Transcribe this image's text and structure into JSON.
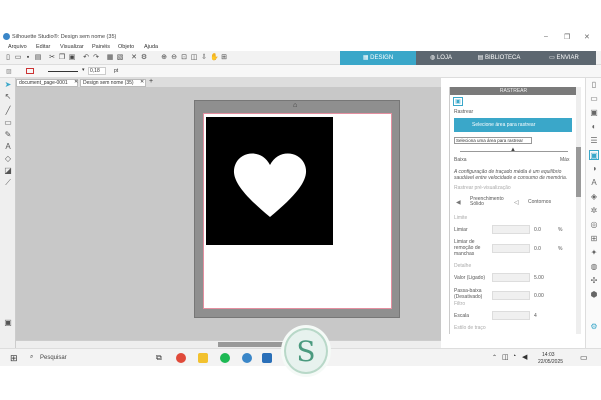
{
  "window": {
    "title": "Silhouette Studio®: Design sem nome (35)"
  },
  "menu": [
    "Arquivo",
    "Editar",
    "Visualizar",
    "Painéis",
    "Objeto",
    "Ajuda"
  ],
  "nav_tabs": [
    "DESIGN",
    "LOJA",
    "BIBLIOTECA",
    "ENVIAR"
  ],
  "options_bar": {
    "line_width": "0,18",
    "unit": "pt"
  },
  "doc_tabs": [
    "document_page-0001",
    "Design sem nome (35)"
  ],
  "panel": {
    "header": "RASTREAR",
    "section_label": "Rastrear",
    "select_button": "Selecione área para rastrear",
    "tooltip": "Seleciona uma área para rastrear",
    "low_label": "Baixa",
    "high_label": "Máx",
    "description": "A configuração de traçado média é um equilíbrio saudável entre velocidade e consumo de memória.",
    "preview_label": "Rastrear pré-visualização",
    "mode_solid": "Preenchimento Sólido",
    "mode_outline": "Contornos",
    "limit_section": "Limite",
    "threshold_label": "Limiar",
    "threshold_value": "0.0",
    "threshold_unit": "%",
    "noise_label": "Limiar de remoção de manchas",
    "noise_value": "0.0",
    "noise_unit": "%",
    "detail_section": "Detalhe",
    "smooth_label": "Valor (Ligado)",
    "smooth_value": "5.00",
    "filter_section": "Filtro",
    "highpass_label": "Passa-baixa (Desativado)",
    "highpass_value": "0.00",
    "scale_section": "Escala",
    "scale_label": "Escala",
    "scale_value": "4",
    "footer_label": "Estilo de traço"
  },
  "taskbar": {
    "search": "Pesquisar",
    "time": "14:03",
    "date": "22/05/2025"
  },
  "colors": {
    "accent": "#3aa7c9",
    "nav_bg": "#5d6770",
    "brand_green": "#4a9a7e"
  }
}
